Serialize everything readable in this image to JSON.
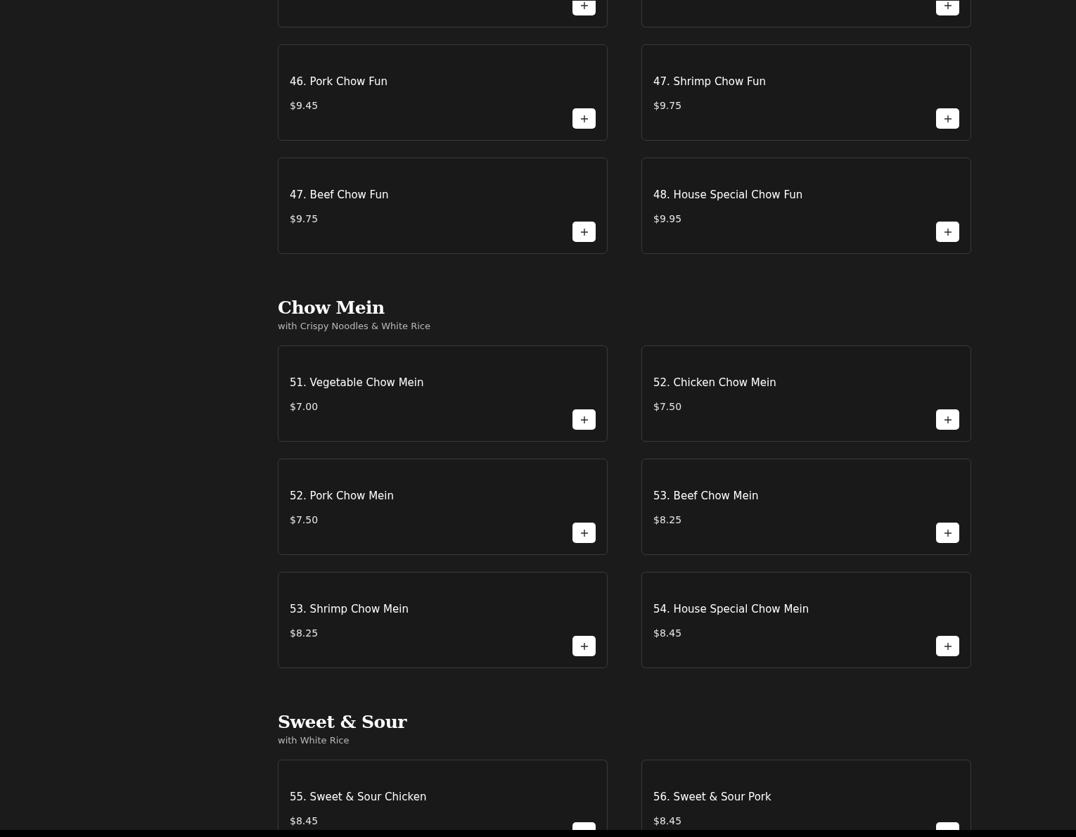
{
  "menu": {
    "sections": [
      {
        "items": [
          {
            "kind": "cut_top"
          },
          {
            "kind": "cut_top"
          },
          {
            "kind": "full",
            "name": "46. Pork Chow Fun",
            "price": "$9.45"
          },
          {
            "kind": "full",
            "name": "47. Shrimp Chow Fun",
            "price": "$9.75"
          },
          {
            "kind": "full",
            "name": "47. Beef Chow Fun",
            "price": "$9.75"
          },
          {
            "kind": "full",
            "name": "48. House Special Chow Fun",
            "price": "$9.95"
          }
        ]
      },
      {
        "title": "Chow Mein",
        "subtitle": "with Crispy Noodles & White Rice",
        "items": [
          {
            "kind": "full",
            "name": "51. Vegetable Chow Mein",
            "price": "$7.00"
          },
          {
            "kind": "full",
            "name": "52. Chicken Chow Mein",
            "price": "$7.50"
          },
          {
            "kind": "full",
            "name": "52. Pork Chow Mein",
            "price": "$7.50"
          },
          {
            "kind": "full",
            "name": "53. Beef Chow Mein",
            "price": "$8.25"
          },
          {
            "kind": "full",
            "name": "53. Shrimp Chow Mein",
            "price": "$8.25"
          },
          {
            "kind": "full",
            "name": "54. House Special Chow Mein",
            "price": "$8.45"
          }
        ]
      },
      {
        "title": "Sweet & Sour",
        "subtitle": "with White Rice",
        "items": [
          {
            "kind": "cut_bottom",
            "name": "55. Sweet & Sour Chicken",
            "price": "$8.45"
          },
          {
            "kind": "cut_bottom",
            "name": "56. Sweet & Sour Pork",
            "price": "$8.45"
          }
        ]
      }
    ]
  }
}
